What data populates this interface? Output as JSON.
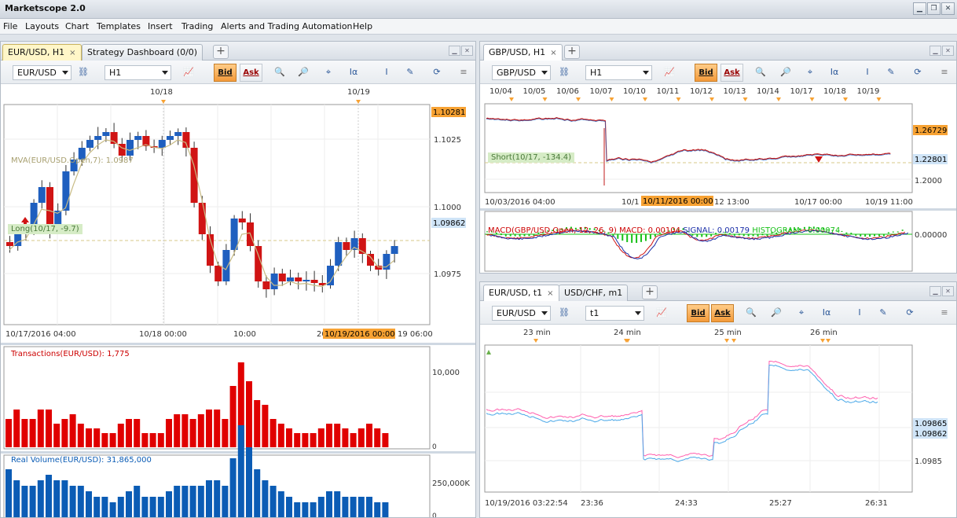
{
  "app": {
    "title": "Marketscope 2.0"
  },
  "window_controls": [
    "minimize",
    "restore",
    "close"
  ],
  "menu": [
    "File",
    "Layouts",
    "Chart",
    "Templates",
    "Insert",
    "Trading",
    "Alerts and Trading Automation",
    "Help"
  ],
  "colors": {
    "bull": "#1f5fbf",
    "bear": "#d01414",
    "accent": "#f7a233",
    "volume_red": "#e00000",
    "volume_blue": "#0b5cb5"
  },
  "left_panel": {
    "tabs": [
      {
        "label": "EUR/USD, H1",
        "close": "×"
      },
      {
        "label": "Strategy Dashboard (0/0)"
      }
    ],
    "add_tab": "+",
    "toolbar": {
      "symbol": "EUR/USD",
      "timeframe": "H1",
      "bid": "Bid",
      "ask": "Ask"
    },
    "top_dates": [
      "10/18",
      "10/19"
    ],
    "indicator_label": "MVA(EUR/USD.Open,7): 1.0987",
    "long_label": "Long(10/17, -9.7)",
    "price_axis": [
      "1.1025",
      "1.1000",
      "1.0975"
    ],
    "price_tag_high": "1.10281",
    "price_tag_last": "1.09862",
    "time_axis": [
      "10/17/2016 04:00",
      "10/18 00:00",
      "10:00",
      "20",
      "10/19/2016 00:00",
      "19 06:00"
    ],
    "transactions_label": "Transactions(EUR/USD): 1,775",
    "transactions_axis": [
      "10,000",
      "0"
    ],
    "volume_label": "Real Volume(EUR/USD): 31,865,000",
    "volume_axis": [
      "250,000K",
      "0"
    ],
    "transactions": [
      6,
      8,
      6,
      6,
      8,
      8,
      5,
      6,
      7,
      5,
      4,
      4,
      3,
      3,
      5,
      6,
      6,
      3,
      3,
      3,
      6,
      7,
      7,
      6,
      7,
      8,
      8,
      6,
      13,
      18,
      14,
      10,
      9,
      6,
      5,
      4,
      3,
      3,
      3,
      4,
      5,
      5,
      4,
      3,
      4,
      5,
      4,
      3
    ],
    "volumes": [
      9,
      7,
      6,
      6,
      7,
      8,
      7,
      7,
      6,
      6,
      5,
      4,
      4,
      3,
      4,
      5,
      6,
      4,
      4,
      4,
      5,
      6,
      6,
      6,
      6,
      7,
      7,
      6,
      11,
      17,
      13,
      9,
      7,
      6,
      5,
      4,
      3,
      3,
      3,
      4,
      5,
      5,
      4,
      4,
      4,
      4,
      3,
      3
    ]
  },
  "gbp_panel": {
    "tabs": [
      {
        "label": "GBP/USD, H1",
        "close": "×"
      }
    ],
    "add_tab": "+",
    "toolbar": {
      "symbol": "GBP/USD",
      "timeframe": "H1",
      "bid": "Bid",
      "ask": "Ask"
    },
    "top_dates": [
      "10/04",
      "10/05",
      "10/06",
      "10/07",
      "10/10",
      "10/11",
      "10/12",
      "10/13",
      "10/14",
      "10/17",
      "10/18",
      "10/19"
    ],
    "short_label": "Short(10/17, -134.4)",
    "price_axis": [
      "1.2000"
    ],
    "price_tag_high": "1.26729",
    "price_tag_last": "1.22801",
    "time_axis": [
      "10/03/2016 04:00",
      "10/1",
      "10/11/2016 00:00",
      "12 13:00",
      "10/17 00:00",
      "10/19 11:00"
    ],
    "macd_label": "MACD(GBP/USD.Open, 12, 26, 9)",
    "macd_value": "MACD: 0.00104",
    "signal_value": "SIGNAL: 0.00179",
    "histogram_value": "HISTOGRAM: -0.00074",
    "macd_axis": "0.00000"
  },
  "tick_panel": {
    "tabs": [
      {
        "label": "EUR/USD, t1",
        "close": "×"
      },
      {
        "label": "USD/CHF, m1"
      }
    ],
    "add_tab": "+",
    "toolbar": {
      "symbol": "EUR/USD",
      "timeframe": "t1",
      "bid": "Bid",
      "ask": "Ask"
    },
    "top_labels": [
      "23 min",
      "24 min",
      "25 min",
      "26 min"
    ],
    "price_tag_ask": "1.09865",
    "price_tag_bid": "1.09862",
    "price_axis": [
      "1.0985"
    ],
    "time_axis": [
      "10/19/2016 03:22:54",
      "23:36",
      "24:33",
      "25:27",
      "26:31"
    ]
  }
}
